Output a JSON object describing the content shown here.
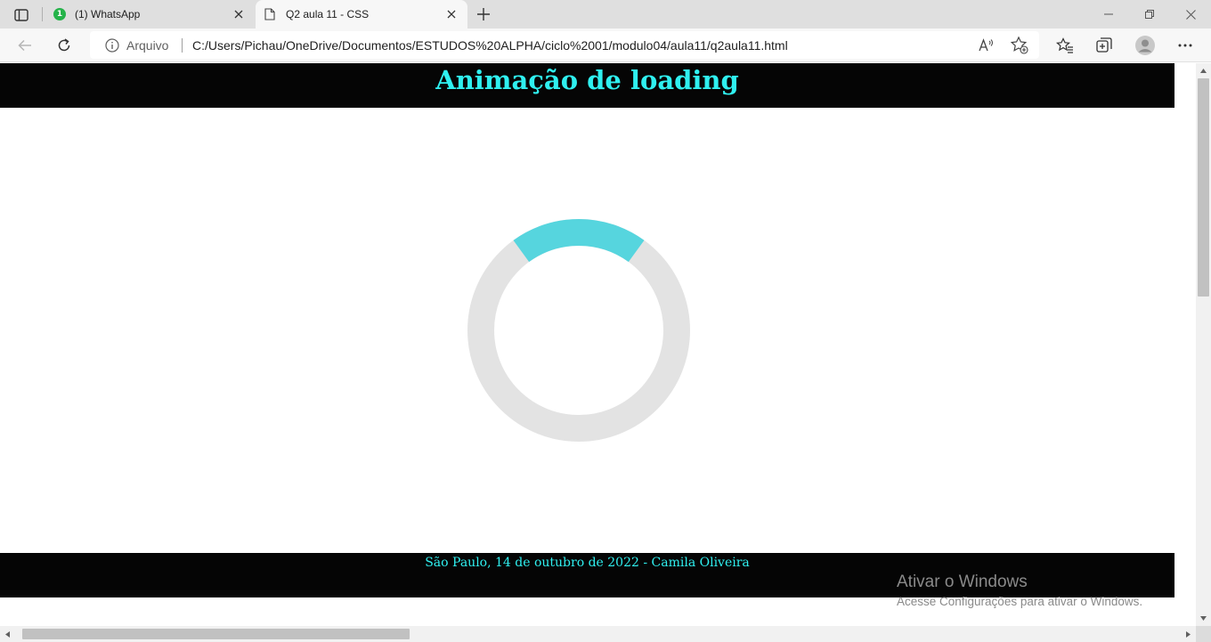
{
  "browser": {
    "tabs": [
      {
        "title": "(1) WhatsApp",
        "badge": "1",
        "active": false,
        "favicon": "whatsapp-icon"
      },
      {
        "title": "Q2 aula 11 - CSS",
        "active": true,
        "favicon": "page-icon"
      }
    ],
    "address_bar": {
      "site_info": "Arquivo",
      "url": "C:/Users/Pichau/OneDrive/Documentos/ESTUDOS%20ALPHA/ciclo%2001/modulo04/aula11/q2aula11.html",
      "read_aloud_label": "A⁾"
    }
  },
  "page": {
    "title": "Animação de loading",
    "footer": "São Paulo, 14 de outubro de 2022 - Camila Oliveira",
    "loader": {
      "track_color": "#e3e3e3",
      "arc_color": "#56d5de",
      "arc_fraction": 0.2
    }
  },
  "watermark": {
    "title": "Ativar o Windows",
    "subtitle": "Acesse Configurações para ativar o Windows."
  },
  "colors": {
    "header_bg": "#050505",
    "title_text": "#2ff0f0"
  }
}
